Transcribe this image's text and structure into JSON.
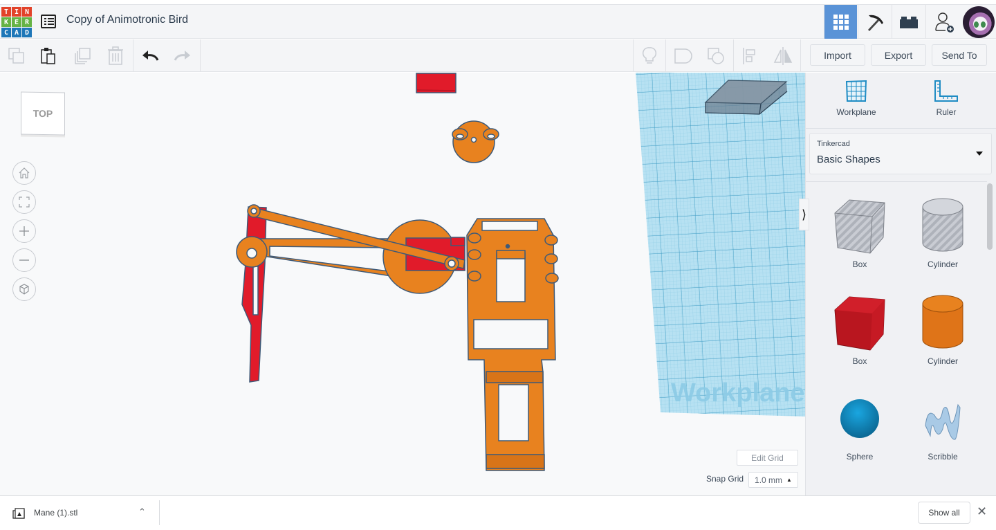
{
  "app": {
    "logo_letters": [
      "T",
      "I",
      "N",
      "K",
      "E",
      "R",
      "C",
      "A",
      "D"
    ],
    "logo_colors": [
      "#e2432a",
      "#e2432a",
      "#e2432a",
      "#66b345",
      "#66b345",
      "#66b345",
      "#1e77b8",
      "#1e77b8",
      "#1e77b8"
    ],
    "document_title": "Copy of Animotronic Bird",
    "accent": "#5a93d7"
  },
  "header": {
    "buttons": [
      {
        "name": "3d-design-view",
        "icon": "grid-icon",
        "active": true
      },
      {
        "name": "codeblocks-view",
        "icon": "pickaxe-icon",
        "active": false
      },
      {
        "name": "bricks-view",
        "icon": "brick-icon",
        "active": false
      },
      {
        "name": "add-collaborator",
        "icon": "user-plus-icon",
        "active": false
      }
    ]
  },
  "toolbar": {
    "copy_label": "Copy",
    "paste_label": "Paste",
    "duplicate_label": "Duplicate",
    "delete_label": "Delete",
    "undo_label": "Undo",
    "redo_label": "Redo",
    "import_label": "Import",
    "export_label": "Export",
    "send_to_label": "Send To"
  },
  "viewport": {
    "viewcube_face": "TOP",
    "nav_buttons": [
      "home-view",
      "fit-all",
      "zoom-in",
      "zoom-out",
      "perspective"
    ],
    "workplane_watermark": "Workplane",
    "edit_grid_label": "Edit Grid",
    "snap_grid_label": "Snap Grid",
    "snap_grid_value": "1.0 mm",
    "colors": {
      "orange": "#e8821f",
      "red": "#e11b2a",
      "outline": "#3e5a78",
      "workplane": "#aad9ee"
    }
  },
  "sidebar": {
    "workplane_label": "Workplane",
    "ruler_label": "Ruler",
    "library_category": "Tinkercad",
    "library_name": "Basic Shapes",
    "shapes": [
      {
        "label": "Box",
        "kind": "box-hole"
      },
      {
        "label": "Cylinder",
        "kind": "cylinder-hole"
      },
      {
        "label": "Box",
        "kind": "box-solid"
      },
      {
        "label": "Cylinder",
        "kind": "cylinder-solid"
      },
      {
        "label": "Sphere",
        "kind": "sphere"
      },
      {
        "label": "Scribble",
        "kind": "scribble"
      }
    ]
  },
  "downloads": {
    "file_name": "Mane (1).stl",
    "show_all_label": "Show all"
  }
}
